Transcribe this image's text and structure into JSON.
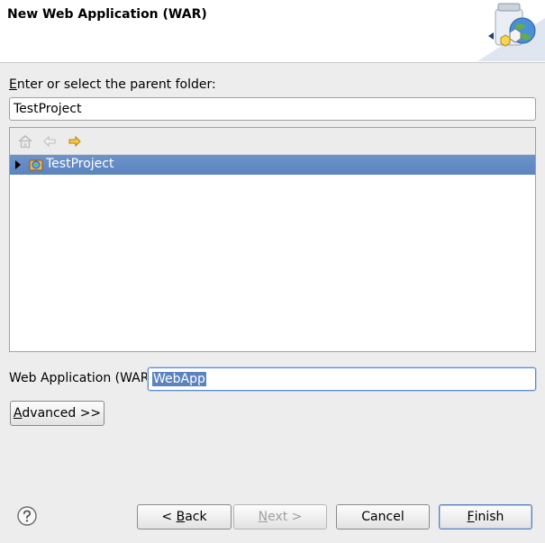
{
  "banner": {
    "title": "New Web Application (WAR)",
    "graphic_icon": "web-application-wizard-icon"
  },
  "parent_folder": {
    "label_prefix": "E",
    "label_rest": "nter or select the parent folder:",
    "value": "TestProject"
  },
  "tree": {
    "toolbar": {
      "home_icon": "home-icon",
      "back_icon": "back-arrow-icon",
      "forward_icon": "forward-arrow-icon"
    },
    "items": [
      {
        "label": "TestProject",
        "icon": "project-icon",
        "selected": true,
        "expanded": false
      }
    ]
  },
  "war": {
    "label": "Web Application (WAR)",
    "value": "WebApp"
  },
  "advanced": {
    "label_prefix": "A",
    "label_rest": "dvanced >>"
  },
  "footer": {
    "help_icon": "help-icon",
    "back": {
      "prefix": "< ",
      "mnemonic": "B",
      "rest": "ack"
    },
    "next": {
      "mnemonic": "N",
      "rest": "ext >"
    },
    "cancel": "Cancel",
    "finish": {
      "mnemonic": "F",
      "rest": "inish"
    }
  },
  "colors": {
    "selection": "#5b83bf",
    "dialog_bg": "#ededed",
    "banner_bg": "#ffffff"
  }
}
